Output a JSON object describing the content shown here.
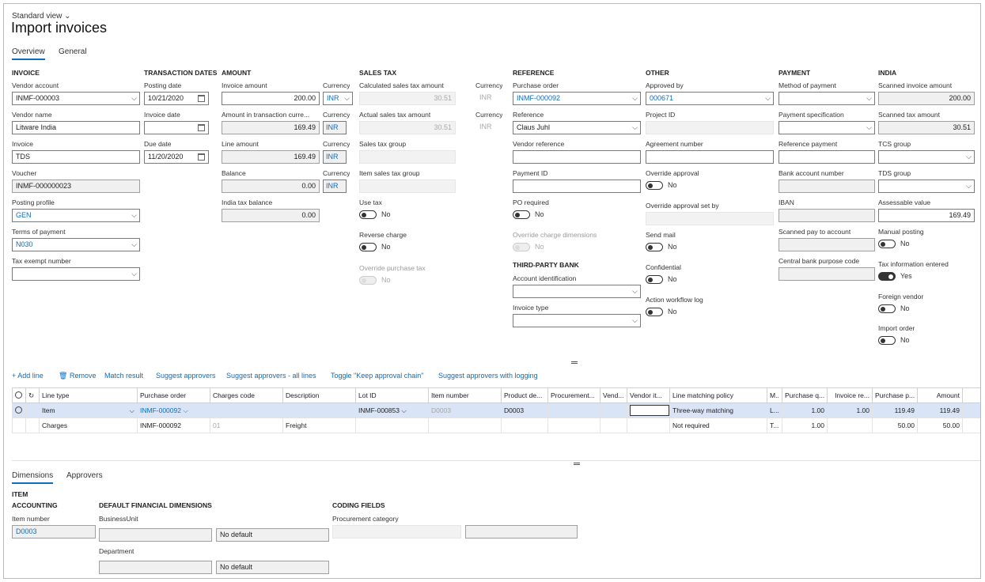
{
  "header": {
    "view": "Standard view",
    "title": "Import invoices"
  },
  "tabs": [
    "Overview",
    "General"
  ],
  "sections": {
    "invoice": "INVOICE",
    "transaction_dates": "TRANSACTION DATES",
    "amount": "AMOUNT",
    "sales_tax": "SALES TAX",
    "reference": "REFERENCE",
    "other": "OTHER",
    "payment": "PAYMENT",
    "india": "INDIA",
    "third_party_bank": "THIRD-PARTY BANK"
  },
  "invoice": {
    "vendor_account_label": "Vendor account",
    "vendor_account": "INMF-000003",
    "vendor_name_label": "Vendor name",
    "vendor_name": "Litware India",
    "invoice_label": "Invoice",
    "invoice": "TDS",
    "voucher_label": "Voucher",
    "voucher": "INMF-000000023",
    "posting_profile_label": "Posting profile",
    "posting_profile": "GEN",
    "terms_label": "Terms of payment",
    "terms": "N030",
    "tax_exempt_label": "Tax exempt number",
    "tax_exempt": ""
  },
  "dates": {
    "posting_label": "Posting date",
    "posting": "10/21/2020",
    "invoice_date_label": "Invoice date",
    "invoice_date": "",
    "due_label": "Due date",
    "due": "11/20/2020"
  },
  "amount": {
    "invoice_amount_label": "Invoice amount",
    "invoice_amount": "200.00",
    "transaction_label": "Amount in transaction curre...",
    "transaction": "169.49",
    "line_amount_label": "Line amount",
    "line_amount": "169.49",
    "balance_label": "Balance",
    "balance": "0.00",
    "india_balance_label": "India tax balance",
    "india_balance": "0.00",
    "currency_label": "Currency",
    "currency": "INR"
  },
  "sales_tax": {
    "calculated_label": "Calculated sales tax amount",
    "calculated": "30.51",
    "actual_label": "Actual sales tax amount",
    "actual": "30.51",
    "group_label": "Sales tax group",
    "item_group_label": "Item sales tax group",
    "currency_label": "Currency",
    "currency": "INR",
    "use_tax_label": "Use tax",
    "use_tax": "No",
    "reverse_label": "Reverse charge",
    "reverse": "No",
    "override_label": "Override purchase tax",
    "override": "No"
  },
  "reference": {
    "po_label": "Purchase order",
    "po": "INMF-000092",
    "ref_label": "Reference",
    "ref": "Claus Juhl",
    "vendor_ref_label": "Vendor reference",
    "payment_id_label": "Payment ID",
    "po_required_label": "PO required",
    "po_required": "No",
    "override_charge_label": "Override charge dimensions",
    "override_charge": "No",
    "account_id_label": "Account identification",
    "invoice_type_label": "Invoice type"
  },
  "other": {
    "approved_label": "Approved by",
    "approved": "000671",
    "project_label": "Project ID",
    "agreement_label": "Agreement number",
    "override_approval_label": "Override approval",
    "override_approval": "No",
    "override_set_label": "Override approval set by",
    "send_mail_label": "Send mail",
    "send_mail": "No",
    "confidential_label": "Confidential",
    "confidential": "No",
    "workflow_label": "Action workflow log",
    "workflow": "No"
  },
  "payment": {
    "method_label": "Method of payment",
    "spec_label": "Payment specification",
    "ref_label": "Reference payment",
    "bank_label": "Bank account number",
    "iban_label": "IBAN",
    "scanned_label": "Scanned pay to account",
    "central_label": "Central bank purpose code"
  },
  "india": {
    "scanned_invoice_label": "Scanned invoice amount",
    "scanned_invoice": "200.00",
    "scanned_tax_label": "Scanned tax amount",
    "scanned_tax": "30.51",
    "tcs_label": "TCS group",
    "tds_label": "TDS group",
    "assessable_label": "Assessable value",
    "assessable": "169.49",
    "manual_label": "Manual posting",
    "manual": "No",
    "tax_info_label": "Tax information entered",
    "tax_info": "Yes",
    "foreign_label": "Foreign vendor",
    "foreign": "No",
    "import_label": "Import order",
    "import": "No"
  },
  "toolbar": {
    "add": "+ Add line",
    "remove": "Remove",
    "match": "Match result",
    "suggest": "Suggest approvers",
    "suggest_all": "Suggest approvers - all lines",
    "toggle": "Toggle \"Keep approval chain\"",
    "suggest_log": "Suggest approvers with logging"
  },
  "grid": {
    "headers": [
      "Line type",
      "Purchase order",
      "Charges code",
      "Description",
      "Lot ID",
      "Item number",
      "Product de...",
      "Procurement...",
      "Vend...",
      "Vendor it...",
      "Line matching policy",
      "M..",
      "Purchase q...",
      "Invoice re...",
      "Purchase p...",
      "Amount"
    ],
    "rows": [
      [
        "Item",
        "INMF-000092",
        "",
        "",
        "INMF-000853",
        "D0003",
        "D0003",
        "",
        "",
        "",
        "Three-way matching",
        "L...",
        "1.00",
        "1.00",
        "119.49",
        "119.49"
      ],
      [
        "Charges",
        "INMF-000092",
        "01",
        "Freight",
        "",
        "",
        "",
        "",
        "",
        "",
        "Not required",
        "T...",
        "1.00",
        "",
        "50.00",
        "50.00"
      ]
    ]
  },
  "bottom": {
    "tabs": [
      "Dimensions",
      "Approvers"
    ],
    "item": "ITEM",
    "accounting": "ACCOUNTING",
    "default_fin": "DEFAULT FINANCIAL DIMENSIONS",
    "coding": "CODING FIELDS",
    "item_number_label": "Item number",
    "item_number": "D0003",
    "bu_label": "BusinessUnit",
    "bu_default": "No default",
    "dept_label": "Department",
    "dept_default": "No default",
    "proc_label": "Procurement category"
  }
}
